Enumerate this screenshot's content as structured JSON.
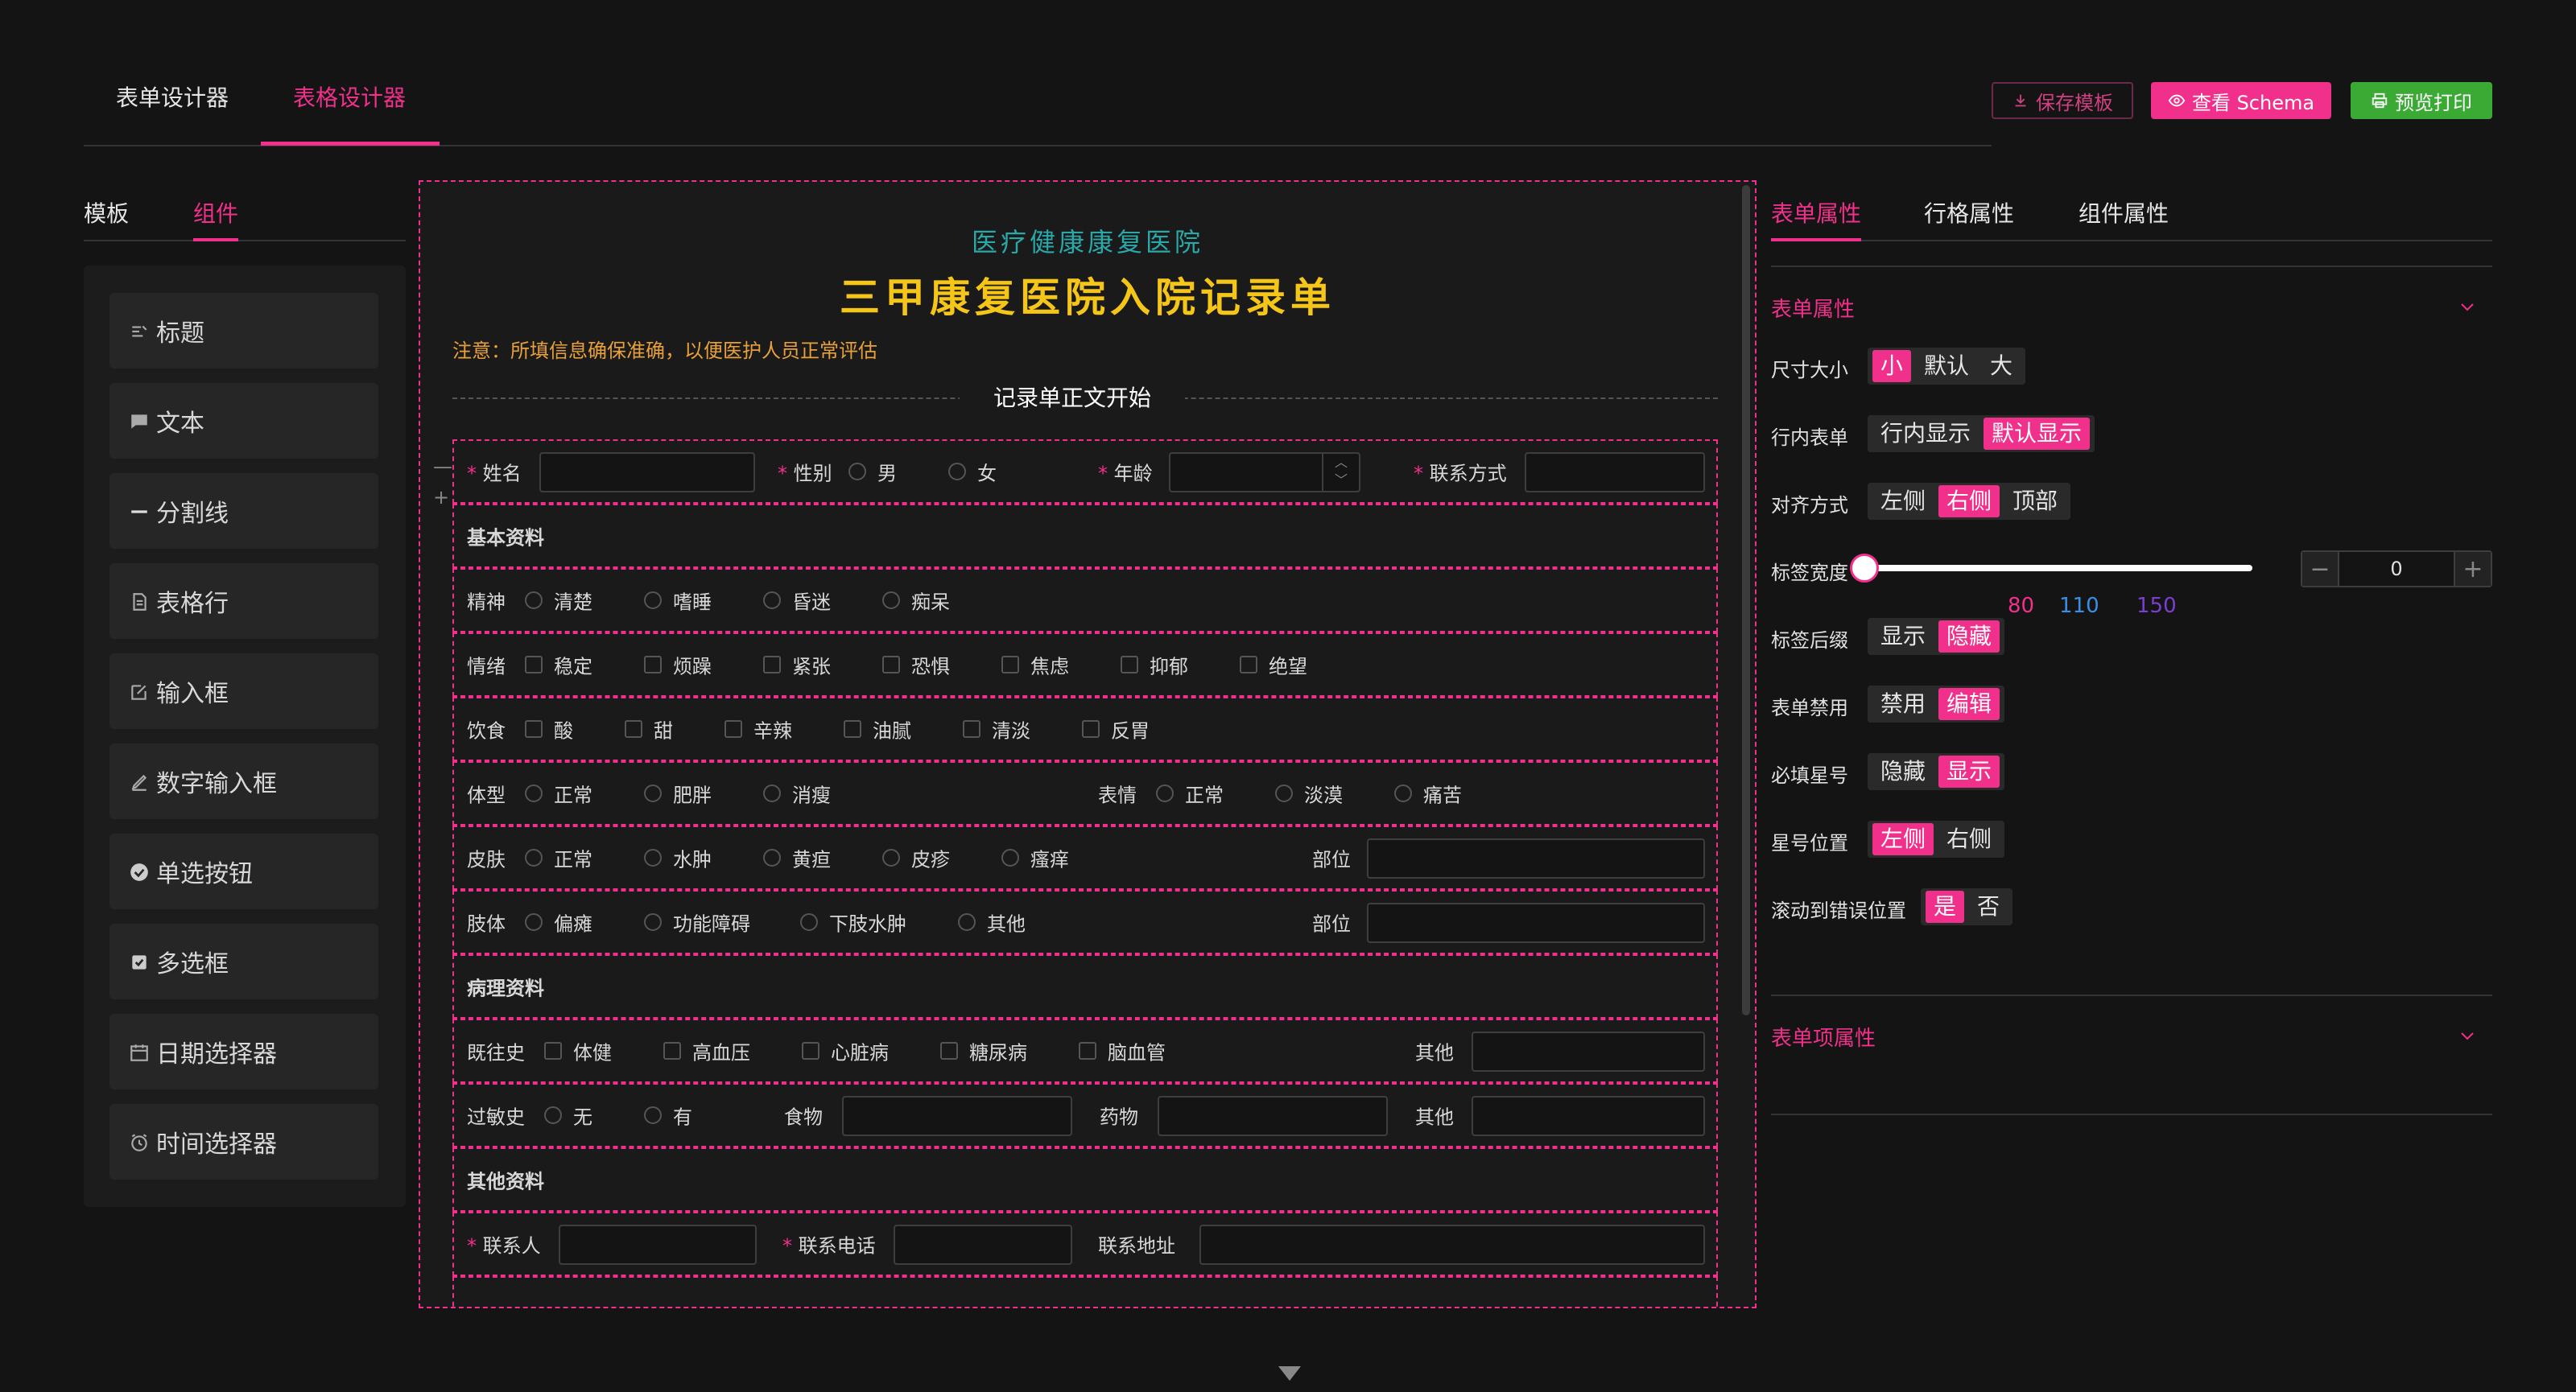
{
  "top_tabs": [
    "表单设计器",
    "表格设计器"
  ],
  "header_buttons": {
    "save": "保存模板",
    "schema": "查看 Schema",
    "preview": "预览打印"
  },
  "left_tabs": [
    "模板",
    "组件"
  ],
  "components": [
    "标题",
    "文本",
    "分割线",
    "表格行",
    "输入框",
    "数字输入框",
    "单选按钮",
    "多选框",
    "日期选择器",
    "时间选择器"
  ],
  "form": {
    "hospital": "医疗健康康复医院",
    "title": "三甲康复医院入院记录单",
    "notice": "注意：所填信息确保准确，以便医护人员正常评估",
    "divider": "记录单正文开始",
    "row1": {
      "name": "姓名",
      "gender": "性别",
      "male": "男",
      "female": "女",
      "age": "年龄",
      "contact": "联系方式"
    },
    "sec_basic": "基本资料",
    "mental": {
      "label": "精神",
      "opts": [
        "清楚",
        "嗜睡",
        "昏迷",
        "痴呆"
      ]
    },
    "emotion": {
      "label": "情绪",
      "opts": [
        "稳定",
        "烦躁",
        "紧张",
        "恐惧",
        "焦虑",
        "抑郁",
        "绝望"
      ]
    },
    "diet": {
      "label": "饮食",
      "opts": [
        "酸",
        "甜",
        "辛辣",
        "油腻",
        "清淡",
        "反胃"
      ]
    },
    "body": {
      "label": "体型",
      "opts": [
        "正常",
        "肥胖",
        "消瘦"
      ],
      "face_label": "表情",
      "face_opts": [
        "正常",
        "淡漠",
        "痛苦"
      ]
    },
    "skin": {
      "label": "皮肤",
      "opts": [
        "正常",
        "水肿",
        "黄疸",
        "皮疹",
        "瘙痒"
      ],
      "part": "部位"
    },
    "limb": {
      "label": "肢体",
      "opts": [
        "偏瘫",
        "功能障碍",
        "下肢水肿",
        "其他"
      ],
      "part": "部位"
    },
    "sec_patho": "病理资料",
    "history": {
      "label": "既往史",
      "opts": [
        "体健",
        "高血压",
        "心脏病",
        "糖尿病",
        "脑血管"
      ],
      "other": "其他"
    },
    "allergy": {
      "label": "过敏史",
      "opts": [
        "无",
        "有"
      ],
      "food": "食物",
      "drug": "药物",
      "other": "其他"
    },
    "sec_other": "其他资料",
    "contact_row": {
      "person": "联系人",
      "phone": "联系电话",
      "address": "联系地址"
    }
  },
  "right_tabs": [
    "表单属性",
    "行格属性",
    "组件属性"
  ],
  "props": {
    "section1": "表单属性",
    "size": {
      "label": "尺寸大小",
      "opts": [
        "小",
        "默认",
        "大"
      ],
      "on": 0
    },
    "inline": {
      "label": "行内表单",
      "opts": [
        "行内显示",
        "默认显示"
      ],
      "on": 1
    },
    "align": {
      "label": "对齐方式",
      "opts": [
        "左侧",
        "右侧",
        "顶部"
      ],
      "on": 1
    },
    "label_width": {
      "label": "标签宽度",
      "value": "0",
      "marks": [
        "80",
        "110",
        "150"
      ]
    },
    "suffix": {
      "label": "标签后缀",
      "opts": [
        "显示",
        "隐藏"
      ],
      "on": 1
    },
    "disabled": {
      "label": "表单禁用",
      "opts": [
        "禁用",
        "编辑"
      ],
      "on": 1
    },
    "required": {
      "label": "必填星号",
      "opts": [
        "隐藏",
        "显示"
      ],
      "on": 1
    },
    "star_pos": {
      "label": "星号位置",
      "opts": [
        "左侧",
        "右侧"
      ],
      "on": 0
    },
    "scroll": {
      "label": "滚动到错误位置",
      "opts": [
        "是",
        "否"
      ],
      "on": 0
    },
    "section2": "表单项属性"
  },
  "colors": {
    "accent": "#f0308a",
    "section": "#65c466",
    "title": "#f5c518",
    "subtitle": "#2aa8a8",
    "notice": "#e8a13a",
    "preview": "#3aaa35"
  }
}
